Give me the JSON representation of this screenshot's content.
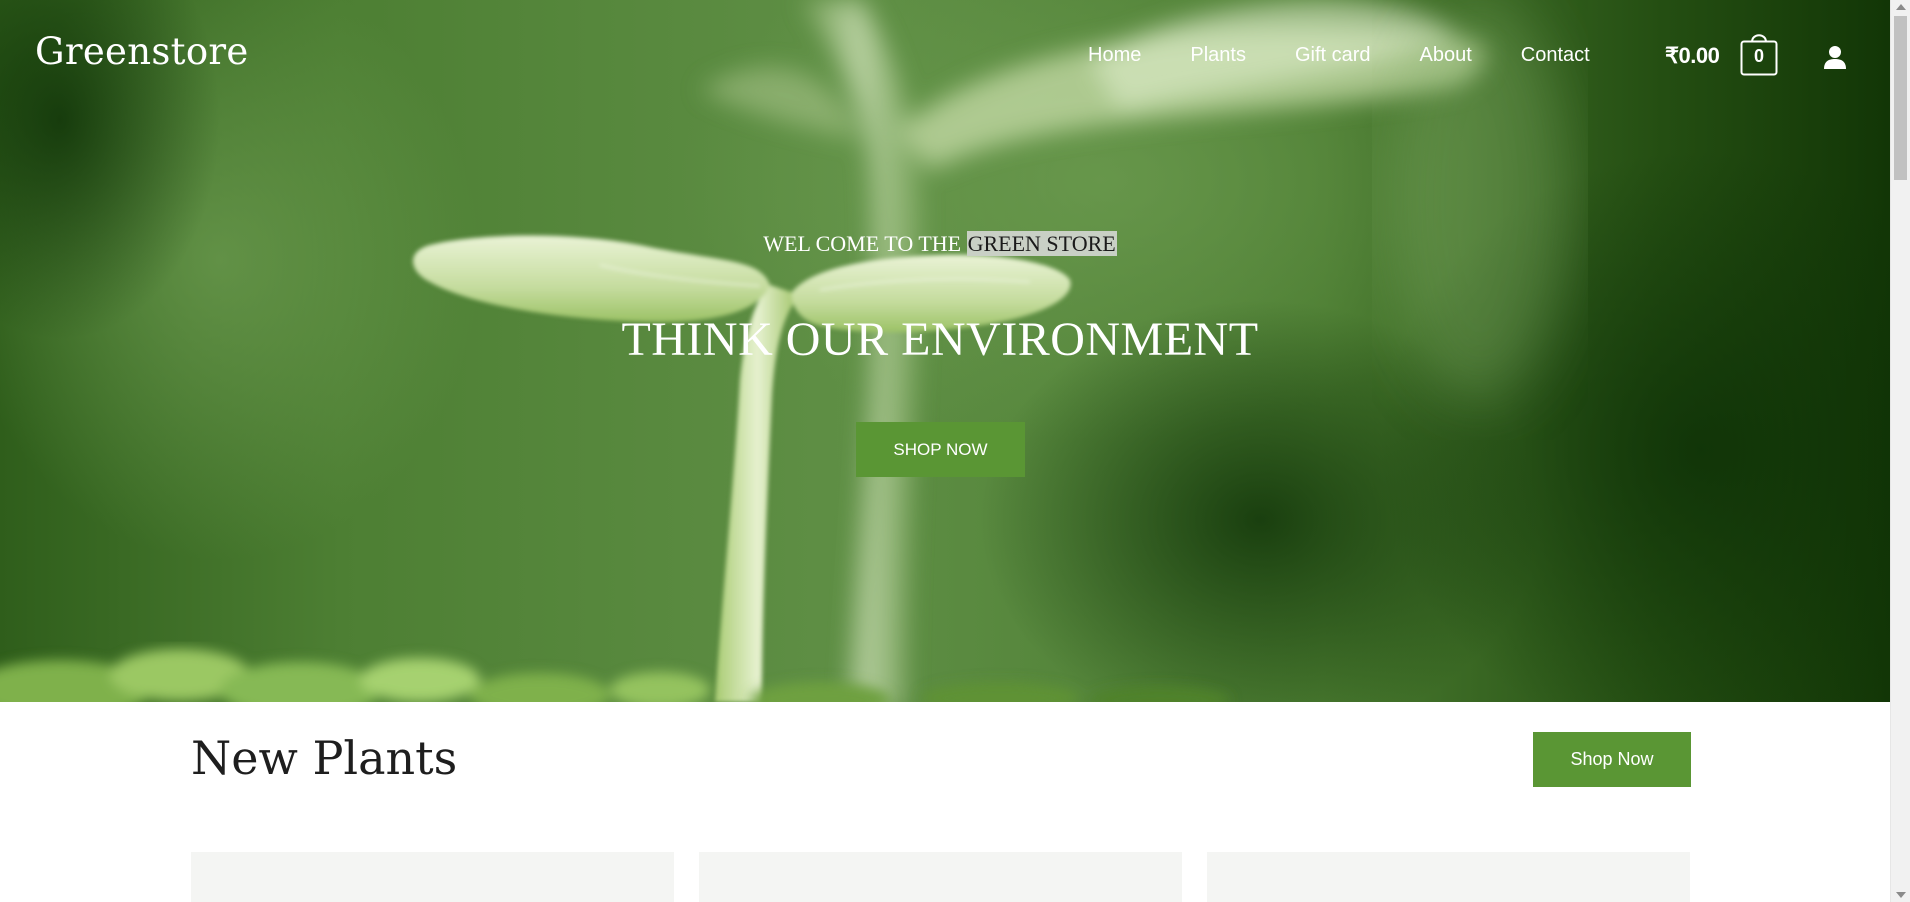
{
  "header": {
    "brand": "Greenstore",
    "nav": [
      {
        "label": "Home"
      },
      {
        "label": "Plants"
      },
      {
        "label": "Gift card"
      },
      {
        "label": "About"
      },
      {
        "label": "Contact"
      }
    ],
    "cart_total": "₹0.00",
    "cart_count": "0",
    "icons": {
      "cart": "shopping-bag-icon",
      "account": "user-icon"
    }
  },
  "hero": {
    "welcome_prefix": "WEL COME TO THE",
    "welcome_highlight": "GREEN STORE",
    "headline": "THINK OUR ENVIRONMENT",
    "cta": "SHOP NOW"
  },
  "new_plants": {
    "title": "New Plants",
    "cta": "Shop Now"
  },
  "colors": {
    "accent": "#5a9634",
    "text_dark": "#1e1e1e",
    "card_bg": "#f4f5f3",
    "highlight_bg": "#c9d0c5"
  }
}
